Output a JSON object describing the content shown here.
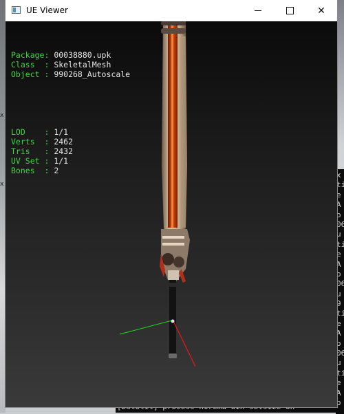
{
  "window": {
    "title": "UE Viewer",
    "controls": {
      "minimize": "minimize",
      "maximize": "maximize",
      "close": "✕"
    }
  },
  "info": {
    "object_lines": [
      {
        "key": "Package: ",
        "value": "00038880.upk"
      },
      {
        "key": "Class  : ",
        "value": "SkeletalMesh"
      },
      {
        "key": "Object : ",
        "value": "990268_Autoscale"
      }
    ],
    "mesh_lines": [
      {
        "key": "LOD    : ",
        "value": "1/1"
      },
      {
        "key": "Verts  : ",
        "value": "2462"
      },
      {
        "key": "Tris   : ",
        "value": "2432"
      },
      {
        "key": "UV Set : ",
        "value": "1/1"
      },
      {
        "key": "Bones  : ",
        "value": "2"
      }
    ]
  },
  "background": {
    "console_right_chars": [
      "x",
      "ti",
      "e",
      "A",
      "o",
      "06",
      "u",
      "ti",
      "e",
      "A",
      "o",
      "06",
      "u",
      "9",
      "ti",
      "e",
      "A",
      "o",
      "06",
      "u",
      "ti",
      "e",
      "A",
      "o"
    ],
    "console_bottom_text": "[DStolil] process  hiremu win setsize  on",
    "desktop_glyph": "x",
    "desktop_glyph_2": "x"
  },
  "colors": {
    "info_key": "#3fd63f",
    "info_value": "#e8e8e8",
    "axis_x": "#e01818",
    "axis_y": "#1ed81e",
    "blade_core": "#d8440c"
  }
}
